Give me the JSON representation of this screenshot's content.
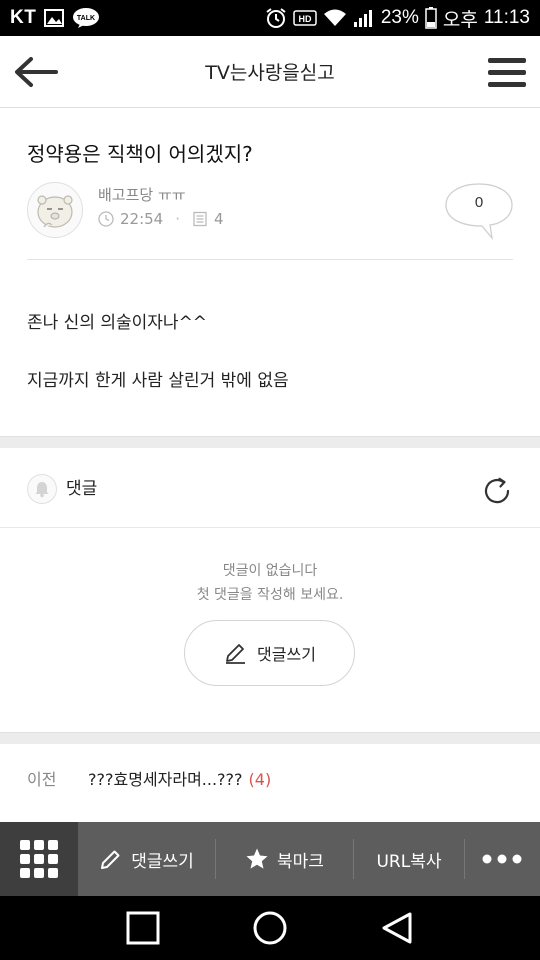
{
  "status_bar": {
    "carrier": "KT",
    "battery": "23%",
    "ampm": "오후",
    "time": "11:13",
    "icons": [
      "image-icon",
      "kakaotalk-icon",
      "alarm-icon",
      "hd-icon",
      "wifi-icon",
      "signal-icon",
      "battery-icon"
    ]
  },
  "header": {
    "title": "TV는사랑을싣고",
    "back_icon": "back-arrow-icon",
    "menu_icon": "hamburger-menu-icon"
  },
  "post": {
    "title": "정약용은 직책이 어의겠지?",
    "author": "배고프당 ㅠㅠ",
    "time": "22:54",
    "views": "4",
    "comment_count": "0",
    "body": [
      "존나 신의 의술이자나^^",
      "지금까지 한게 사람 살린거 밖에 없음"
    ]
  },
  "comments": {
    "label": "댓글",
    "empty_line1": "댓글이 없습니다",
    "empty_line2": "첫 댓글을 작성해 보세요.",
    "write_button": "댓글쓰기"
  },
  "prev_post": {
    "label": "이전",
    "title": "???효명세자라며...???",
    "count": "(4)"
  },
  "toolbar": {
    "write": "댓글쓰기",
    "bookmark": "북마크",
    "copy_url": "URL복사"
  },
  "colors": {
    "status_bar": "#000000",
    "toolbar": "#5d5d5d",
    "toolbar_grid": "#3e3e3e",
    "accent_count": "#d9534f"
  }
}
